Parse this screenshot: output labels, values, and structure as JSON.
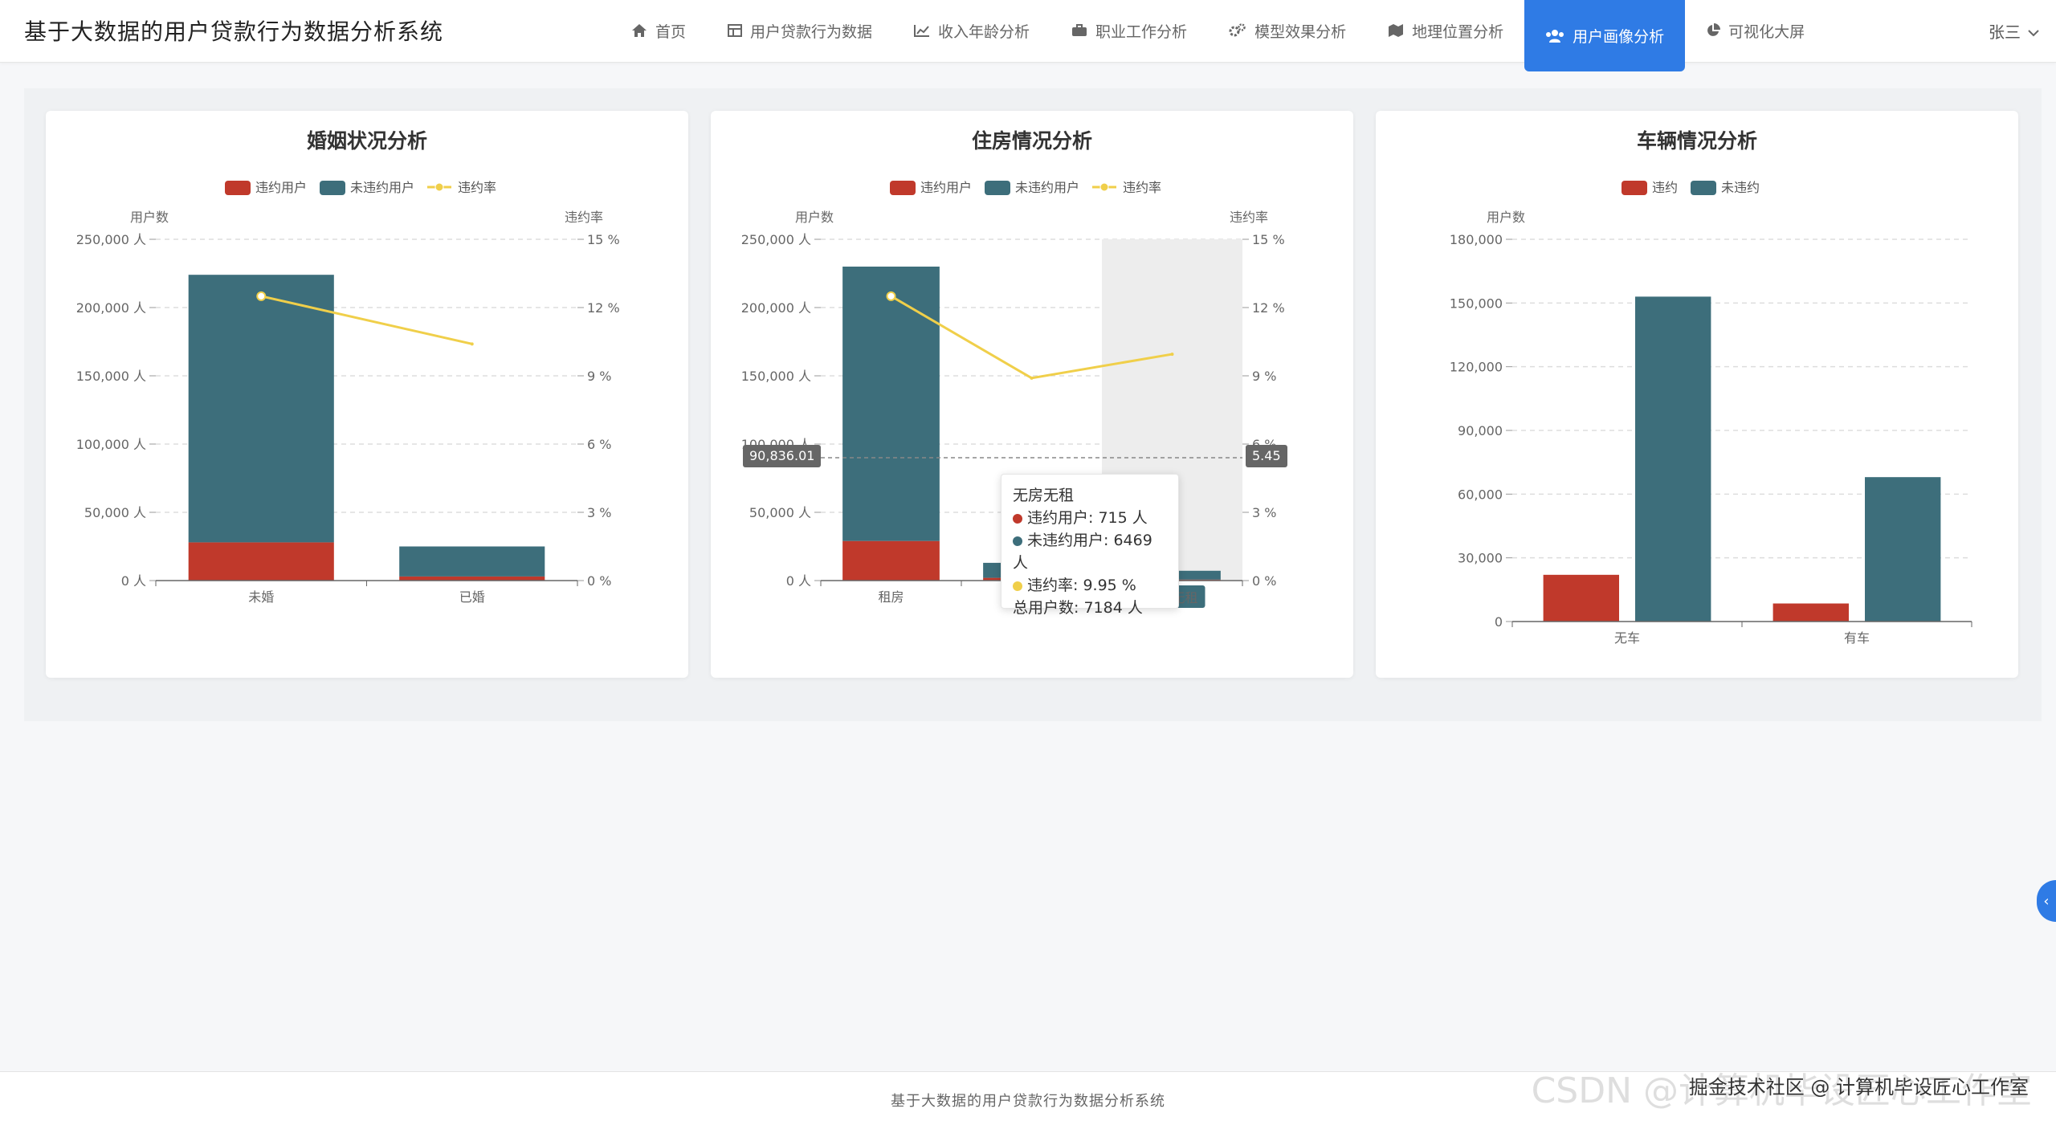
{
  "app": {
    "title": "基于大数据的用户贷款行为数据分析系统"
  },
  "nav": [
    {
      "label": "首页",
      "icon": "home-icon"
    },
    {
      "label": "用户贷款行为数据",
      "icon": "table-icon"
    },
    {
      "label": "收入年龄分析",
      "icon": "line-chart-icon"
    },
    {
      "label": "职业工作分析",
      "icon": "briefcase-icon"
    },
    {
      "label": "模型效果分析",
      "icon": "gears-icon"
    },
    {
      "label": "地理位置分析",
      "icon": "map-icon"
    },
    {
      "label": "用户画像分析",
      "icon": "users-icon",
      "active": true
    },
    {
      "label": "可视化大屏",
      "icon": "pie-chart-icon"
    }
  ],
  "user": {
    "name": "张三"
  },
  "colors": {
    "accent": "#2f7be5",
    "default": "#c0392b",
    "nondefault": "#3d6e7b",
    "rate": "#f0cf4a"
  },
  "charts": {
    "marriage": {
      "title": "婚姻状况分析"
    },
    "housing": {
      "title": "住房情况分析"
    },
    "vehicle": {
      "title": "车辆情况分析"
    }
  },
  "chart_data": [
    {
      "type": "bar",
      "title": "婚姻状况分析",
      "categories": [
        "未婚",
        "已婚"
      ],
      "stacked": true,
      "series": [
        {
          "name": "违约用户",
          "values": [
            28000,
            3000
          ]
        },
        {
          "name": "未违约用户",
          "values": [
            196000,
            22000
          ]
        },
        {
          "name": "违约率",
          "type": "line",
          "axis": "right",
          "values": [
            12.5,
            10.4
          ]
        }
      ],
      "ylabel": "用户数",
      "y2label": "违约率",
      "ylim": [
        0,
        250000
      ],
      "y2lim": [
        0,
        15
      ],
      "yticks": [
        "0 人",
        "50,000 人",
        "100,000 人",
        "150,000 人",
        "200,000 人",
        "250,000 人"
      ],
      "y2ticks": [
        "0 %",
        "3 %",
        "6 %",
        "9 %",
        "12 %",
        "15 %"
      ],
      "legend": "top-center"
    },
    {
      "type": "bar",
      "title": "住房情况分析",
      "categories": [
        "租房",
        "",
        "无房无租"
      ],
      "stacked": true,
      "series": [
        {
          "name": "违约用户",
          "values": [
            29000,
            2000,
            715
          ]
        },
        {
          "name": "未违约用户",
          "values": [
            201000,
            11000,
            6469
          ]
        },
        {
          "name": "违约率",
          "type": "line",
          "axis": "right",
          "values": [
            12.5,
            8.9,
            9.95
          ]
        }
      ],
      "ylabel": "用户数",
      "y2label": "违约率",
      "ylim": [
        0,
        250000
      ],
      "y2lim": [
        0,
        15
      ],
      "yticks": [
        "0 人",
        "50,000 人",
        "100,000 人",
        "150,000 人",
        "200,000 人",
        "250,000 人"
      ],
      "y2ticks": [
        "0 %",
        "3 %",
        "6 %",
        "9 %",
        "12 %",
        "15 %"
      ],
      "legend": "top-center",
      "tooltip": {
        "category": "无房无租",
        "default_label": "违约用户: 715 人",
        "nondefault_label": "未违约用户: 6469 人",
        "rate_label": "违约率: 9.95 %",
        "total_label": "总用户数: 7184 人"
      },
      "crosshair": {
        "left": "90,836.01",
        "right": "5.45"
      }
    },
    {
      "type": "bar",
      "title": "车辆情况分析",
      "categories": [
        "无车",
        "有车"
      ],
      "series": [
        {
          "name": "违约",
          "values": [
            22000,
            8500
          ]
        },
        {
          "name": "未违约",
          "values": [
            153000,
            68000
          ]
        }
      ],
      "ylabel": "用户数",
      "ylim": [
        0,
        180000
      ],
      "yticks": [
        "0",
        "30,000",
        "60,000",
        "90,000",
        "120,000",
        "150,000",
        "180,000"
      ],
      "legend": "top-center"
    }
  ],
  "footer": {
    "text": "基于大数据的用户贷款行为数据分析系统"
  },
  "watermark": {
    "text": "CSDN @计算机毕设匠心工作室",
    "caption": "掘金技术社区 @ 计算机毕设匠心工作室"
  }
}
